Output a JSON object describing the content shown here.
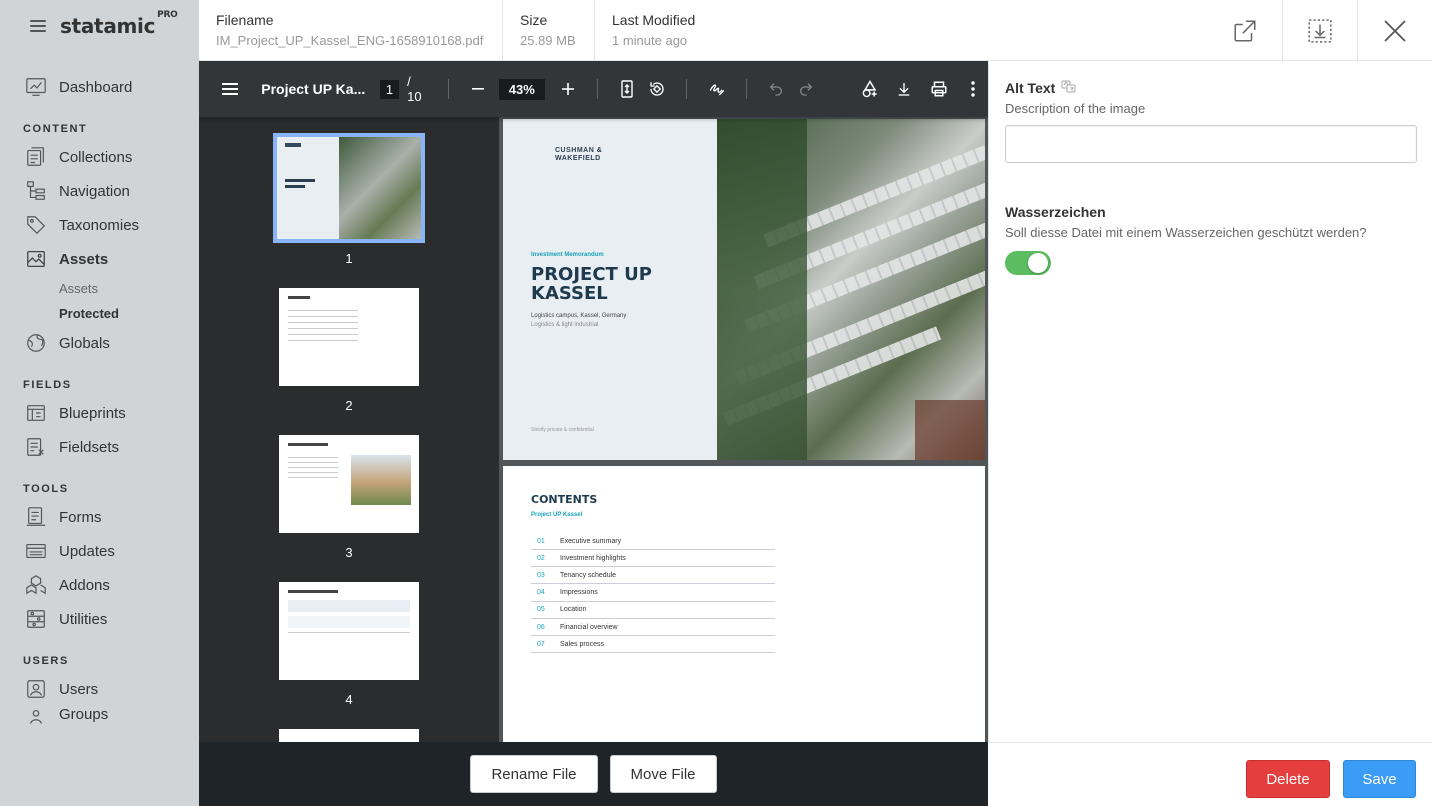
{
  "app": {
    "brand": "statamic",
    "brand_tier": "PRO"
  },
  "sidebar": {
    "top_items": [
      {
        "label": "Dashboard",
        "icon": "dashboard-icon"
      }
    ],
    "sections": [
      {
        "title": "CONTENT",
        "items": [
          {
            "label": "Collections",
            "icon": "collections-icon"
          },
          {
            "label": "Navigation",
            "icon": "navigation-icon"
          },
          {
            "label": "Taxonomies",
            "icon": "tag-icon"
          },
          {
            "label": "Assets",
            "icon": "assets-icon",
            "active": true,
            "subitems": [
              "Assets",
              "Protected"
            ],
            "active_sub": "Protected"
          },
          {
            "label": "Globals",
            "icon": "globe-icon"
          }
        ]
      },
      {
        "title": "FIELDS",
        "items": [
          {
            "label": "Blueprints",
            "icon": "blueprint-icon"
          },
          {
            "label": "Fieldsets",
            "icon": "fieldset-icon"
          }
        ]
      },
      {
        "title": "TOOLS",
        "items": [
          {
            "label": "Forms",
            "icon": "forms-icon"
          },
          {
            "label": "Updates",
            "icon": "updates-icon"
          },
          {
            "label": "Addons",
            "icon": "addons-icon"
          },
          {
            "label": "Utilities",
            "icon": "utilities-icon"
          }
        ]
      },
      {
        "title": "USERS",
        "items": [
          {
            "label": "Users",
            "icon": "users-icon"
          },
          {
            "label": "Groups",
            "icon": "groups-icon"
          }
        ]
      }
    ]
  },
  "asset": {
    "filename_label": "Filename",
    "filename": "IM_Project_UP_Kassel_ENG-1658910168.pdf",
    "size_label": "Size",
    "size": "25.89 MB",
    "modified_label": "Last Modified",
    "modified": "1 minute ago"
  },
  "viewer": {
    "title": "Project UP Ka...",
    "current_page": "1",
    "total_pages": "/ 10",
    "zoom": "43%",
    "thumbnails": [
      "1",
      "2",
      "3",
      "4"
    ],
    "page1": {
      "logo_line1": "CUSHMAN &",
      "logo_line2": "WAKEFIELD",
      "kicker": "Investment Memorandum",
      "heading_line1": "PROJECT UP",
      "heading_line2": "KASSEL",
      "sub1": "Logistics campus, Kassel, Germany",
      "sub2": "Logistics & light industrial",
      "footer": "Strictly private & confidential"
    },
    "page2": {
      "heading": "CONTENTS",
      "subheading": "Project UP Kassel",
      "toc": [
        {
          "num": "01",
          "title": "Executive summary"
        },
        {
          "num": "02",
          "title": "Investment highlights"
        },
        {
          "num": "03",
          "title": "Tenancy schedule"
        },
        {
          "num": "04",
          "title": "Impressions"
        },
        {
          "num": "05",
          "title": "Location"
        },
        {
          "num": "06",
          "title": "Financial overview"
        },
        {
          "num": "07",
          "title": "Sales process"
        }
      ]
    }
  },
  "footer": {
    "rename_label": "Rename File",
    "move_label": "Move File",
    "delete_label": "Delete",
    "save_label": "Save"
  },
  "fields": {
    "alt_text": {
      "label": "Alt Text",
      "description": "Description of the image",
      "value": ""
    },
    "watermark": {
      "label": "Wasserzeichen",
      "description": "Soll diesse Datei mit einem Wasserzeichen geschützt werden?",
      "enabled": true
    }
  },
  "colors": {
    "delete": "#e53e3e",
    "save": "#3b9cf5",
    "toggle_on": "#5cbd60",
    "sidebar_bg": "#d1d4d7"
  }
}
